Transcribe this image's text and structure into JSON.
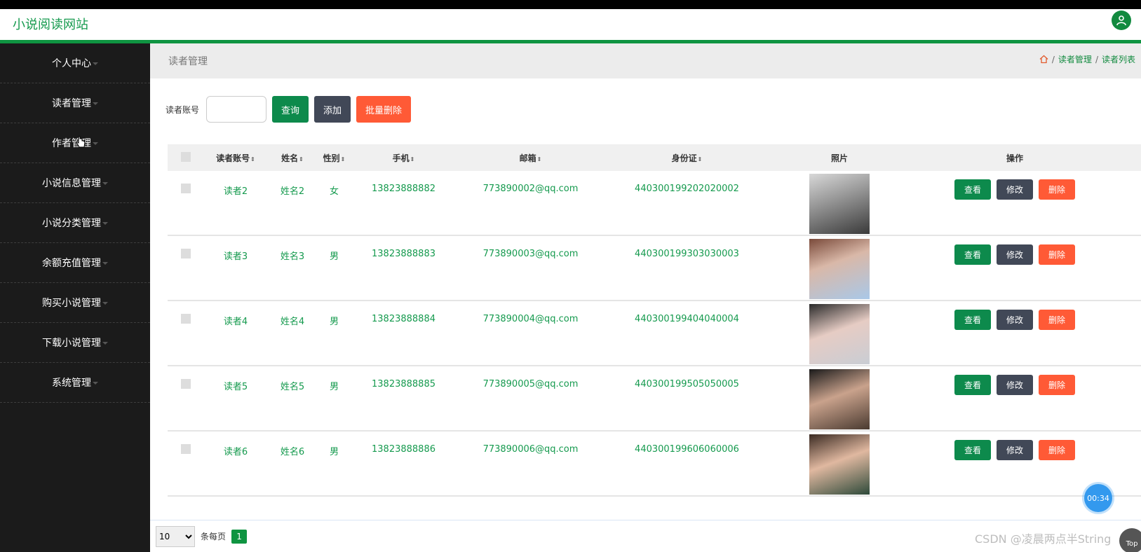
{
  "header": {
    "brand": "小说阅读网站",
    "user_icon": "user-icon"
  },
  "sidebar": {
    "items": [
      {
        "label": "个人中心"
      },
      {
        "label": "读者管理"
      },
      {
        "label": "作者管理"
      },
      {
        "label": "小说信息管理"
      },
      {
        "label": "小说分类管理"
      },
      {
        "label": "余额充值管理"
      },
      {
        "label": "购买小说管理"
      },
      {
        "label": "下载小说管理"
      },
      {
        "label": "系统管理"
      }
    ]
  },
  "page": {
    "title": "读者管理",
    "breadcrumb": [
      "读者管理",
      "读者列表"
    ]
  },
  "search": {
    "label": "读者账号",
    "value": "",
    "query_label": "查询",
    "add_label": "添加",
    "batch_delete_label": "批量删除"
  },
  "table": {
    "columns": [
      "读者账号",
      "姓名",
      "性别",
      "手机",
      "邮箱",
      "身份证",
      "照片",
      "操作"
    ],
    "rows": [
      {
        "account": "读者2",
        "name": "姓名2",
        "sex": "女",
        "phone": "13823888882",
        "email": "773890002@qq.com",
        "idcard": "440300199202020002"
      },
      {
        "account": "读者3",
        "name": "姓名3",
        "sex": "男",
        "phone": "13823888883",
        "email": "773890003@qq.com",
        "idcard": "440300199303030003"
      },
      {
        "account": "读者4",
        "name": "姓名4",
        "sex": "男",
        "phone": "13823888884",
        "email": "773890004@qq.com",
        "idcard": "440300199404040004"
      },
      {
        "account": "读者5",
        "name": "姓名5",
        "sex": "男",
        "phone": "13823888885",
        "email": "773890005@qq.com",
        "idcard": "440300199505050005"
      },
      {
        "account": "读者6",
        "name": "姓名6",
        "sex": "男",
        "phone": "13823888886",
        "email": "773890006@qq.com",
        "idcard": "440300199606060006"
      }
    ],
    "actions": {
      "view": "查看",
      "edit": "修改",
      "delete": "删除"
    }
  },
  "pager": {
    "page_size": "10",
    "per_page_label": "条每页",
    "current_page": "1"
  },
  "overlay": {
    "timer": "00:34",
    "watermark": "CSDN @凌晨两点半String",
    "top_label": "Top"
  },
  "colors": {
    "accent": "#0f9441",
    "sidebar": "#1b1b1b",
    "danger": "#ff5a36",
    "dark_button": "#414857"
  }
}
